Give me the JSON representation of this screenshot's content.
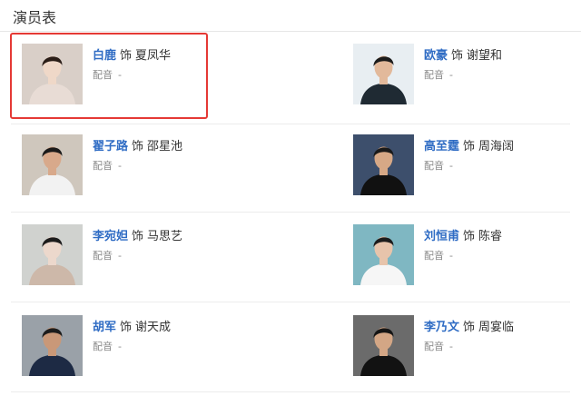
{
  "header": {
    "title": "演员表"
  },
  "cast": [
    {
      "actor": "白鹿",
      "role_word": "饰",
      "role": "夏凤华",
      "voice_label": "配音",
      "voice_value": "-",
      "photo": {
        "bg": "#d9cfc8",
        "skin": "#efd8c8",
        "hair": "#2a1d17",
        "shirt": "#e8dcd5"
      }
    },
    {
      "actor": "欧豪",
      "role_word": "饰",
      "role": "谢望和",
      "voice_label": "配音",
      "voice_value": "-",
      "photo": {
        "bg": "#e8eef2",
        "skin": "#e2b99b",
        "hair": "#1b1b1b",
        "shirt": "#1f2a33"
      }
    },
    {
      "actor": "翟子路",
      "role_word": "饰",
      "role": "邵星池",
      "voice_label": "配音",
      "voice_value": "-",
      "photo": {
        "bg": "#cfc7bd",
        "skin": "#d8a98b",
        "hair": "#1a1a1a",
        "shirt": "#f2f2f2"
      }
    },
    {
      "actor": "高至霆",
      "role_word": "饰",
      "role": "周海阔",
      "voice_label": "配音",
      "voice_value": "-",
      "photo": {
        "bg": "#3d4f6c",
        "skin": "#d6a886",
        "hair": "#1a1a1a",
        "shirt": "#111111"
      }
    },
    {
      "actor": "李宛妲",
      "role_word": "饰",
      "role": "马思艺",
      "voice_label": "配音",
      "voice_value": "-",
      "photo": {
        "bg": "#d0d2cf",
        "skin": "#ecd8cc",
        "hair": "#1c1c1c",
        "shirt": "#cdb8a9"
      }
    },
    {
      "actor": "刘恒甫",
      "role_word": "饰",
      "role": "陈睿",
      "voice_label": "配音",
      "voice_value": "-",
      "photo": {
        "bg": "#7fb7c2",
        "skin": "#e7c4ab",
        "hair": "#1c1c1c",
        "shirt": "#f6f6f6"
      }
    },
    {
      "actor": "胡军",
      "role_word": "饰",
      "role": "谢天成",
      "voice_label": "配音",
      "voice_value": "-",
      "photo": {
        "bg": "#9aa1a8",
        "skin": "#c99878",
        "hair": "#1c1c1c",
        "shirt": "#1d2a44"
      }
    },
    {
      "actor": "李乃文",
      "role_word": "饰",
      "role": "周宴临",
      "voice_label": "配音",
      "voice_value": "-",
      "photo": {
        "bg": "#6b6b6b",
        "skin": "#d3a685",
        "hair": "#151515",
        "shirt": "#121212"
      }
    }
  ],
  "colors": {
    "accent": "#2f6cc4",
    "highlight": "#e53935"
  }
}
